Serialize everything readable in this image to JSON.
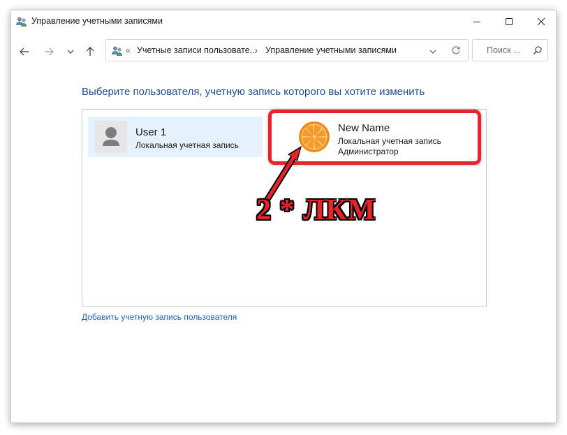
{
  "window": {
    "title": "Управление учетными записями",
    "icon": "users-icon"
  },
  "navbar": {
    "back_icon": "arrow-left-icon",
    "forward_icon": "arrow-right-icon",
    "recent_icon": "chevron-down-icon",
    "up_icon": "arrow-up-icon",
    "address": {
      "overflow": "«",
      "crumbs": [
        "Учетные записи пользовате...",
        "Управление учетными записями"
      ],
      "separator": "›"
    },
    "search_placeholder": "Поиск ..."
  },
  "main": {
    "heading": "Выберите пользователя, учетную запись которого вы хотите изменить",
    "users": [
      {
        "name": "User 1",
        "type": "Локальная учетная запись",
        "role": "",
        "avatar": "default-user-icon",
        "selected": true
      },
      {
        "name": "New Name",
        "type": "Локальная учетная запись",
        "role": "Администратор",
        "avatar": "orange-slice-icon",
        "selected": false
      }
    ],
    "add_link": "Добавить учетную запись пользователя"
  },
  "annotation": {
    "text": "2 * ЛКМ",
    "color": "#e8242b"
  },
  "colors": {
    "heading": "#1f4e92",
    "link": "#1f5fbf",
    "tile_selected_bg": "#e5f1fb"
  }
}
